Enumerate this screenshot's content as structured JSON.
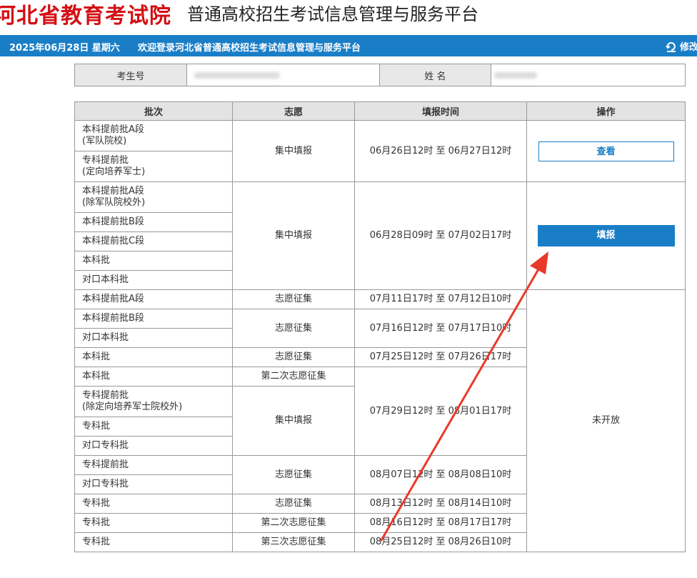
{
  "header": {
    "logo_text": "河北省教育考试院",
    "subtitle": "普通高校招生考试信息管理与服务平台"
  },
  "topbar": {
    "date": "2025年06月28日 星期六",
    "welcome": "欢迎登录河北省普通高校招生考试信息管理与服务平台",
    "modify_label": "修改"
  },
  "info": {
    "exam_no_label": "考生号",
    "name_label": "姓 名"
  },
  "table": {
    "headers": [
      "批次",
      "志愿",
      "填报时间",
      "操作"
    ],
    "batches": [
      "本科提前批A段\n(军队院校)",
      "专科提前批\n(定向培养军士)",
      "本科提前批A段\n(除军队院校外)",
      "本科提前批B段",
      "本科提前批C段",
      "本科批",
      "对口本科批",
      "本科提前批A段",
      "本科提前批B段",
      "对口本科批",
      "本科批",
      "本科批",
      "专科提前批\n(除定向培养军士院校外)",
      "专科批",
      "对口专科批",
      "专科提前批",
      "对口专科批",
      "专科批",
      "专科批",
      "专科批"
    ],
    "types": [
      "集中填报",
      "集中填报",
      "志愿征集",
      "志愿征集",
      "志愿征集",
      "第二次志愿征集",
      "集中填报",
      "志愿征集",
      "志愿征集",
      "第二次志愿征集",
      "第三次志愿征集"
    ],
    "times": [
      "06月26日12时 至 06月27日12时",
      "06月28日09时 至 07月02日17时",
      "07月11日17时 至 07月12日10时",
      "07月16日12时 至 07月17日10时",
      "07月25日12时 至 07月26日17时",
      "07月29日12时 至 08月01日17时",
      "08月07日12时 至 08月08日10时",
      "08月13日12时 至 08月14日10时",
      "08月16日12时 至 08月17日17时",
      "08月25日12时 至 08月26日10时"
    ],
    "actions": {
      "view": "查看",
      "fill": "填报",
      "not_open": "未开放"
    }
  },
  "colors": {
    "brand_red": "#d40f14",
    "bar_blue": "#1a7ec7",
    "arrow_red": "#e8392b"
  }
}
